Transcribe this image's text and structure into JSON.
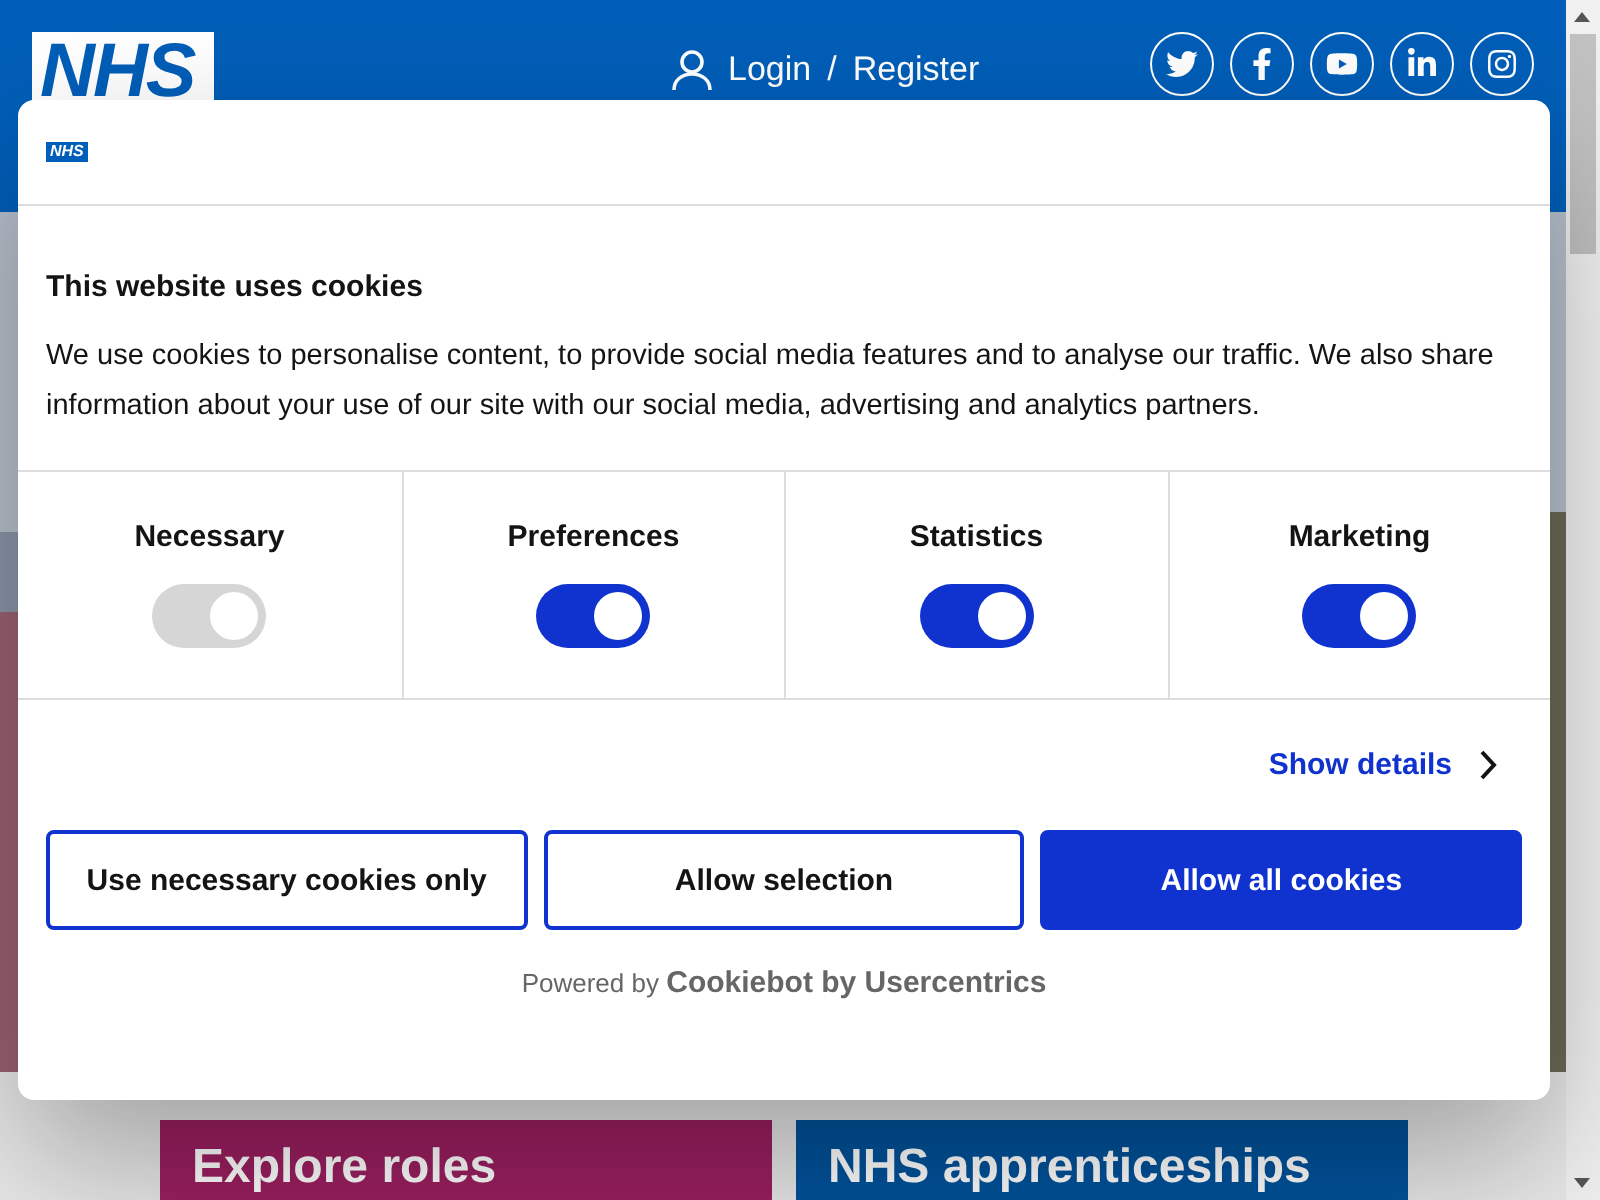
{
  "header": {
    "logo": "NHS",
    "login": "Login",
    "separator": "/",
    "register": "Register"
  },
  "cards": [
    {
      "title": "Explore roles",
      "color": "#9b1f60"
    },
    {
      "title": "NHS apprenticeships",
      "color": "#00529b"
    }
  ],
  "cookie_dialog": {
    "logo": "NHS",
    "title": "This website uses cookies",
    "body": "We use cookies to personalise content, to provide social media features and to analyse our traffic. We also share information about your use of our site with our social media, advertising and analytics partners.",
    "toggles": [
      {
        "label": "Necessary",
        "checked": true,
        "disabled": true
      },
      {
        "label": "Preferences",
        "checked": true,
        "disabled": false
      },
      {
        "label": "Statistics",
        "checked": true,
        "disabled": false
      },
      {
        "label": "Marketing",
        "checked": true,
        "disabled": false
      }
    ],
    "show_details": "Show details",
    "buttons": [
      {
        "label": "Use necessary cookies only",
        "kind": "outline"
      },
      {
        "label": "Allow selection",
        "kind": "outline"
      },
      {
        "label": "Allow all cookies",
        "kind": "primary"
      }
    ],
    "powered_by": "Powered by",
    "powered_brand": "Cookiebot by Usercentrics"
  }
}
